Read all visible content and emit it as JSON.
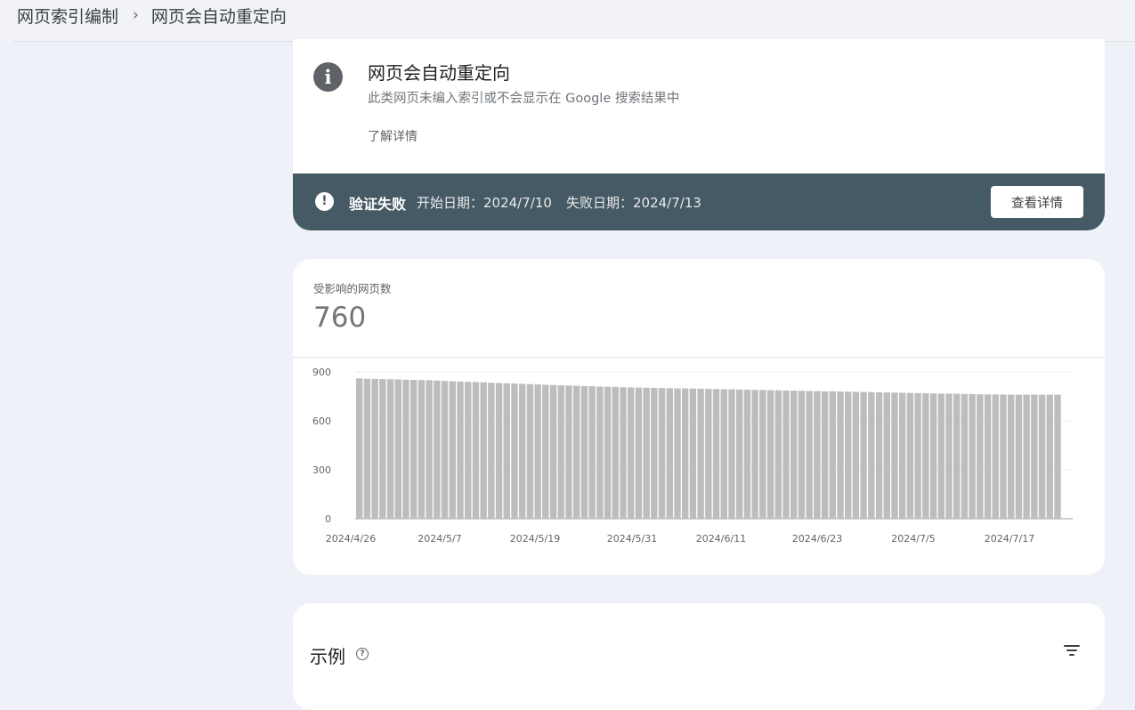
{
  "breadcrumb": {
    "parent": "网页索引编制",
    "separator": "›",
    "current": "网页会自动重定向"
  },
  "issue": {
    "icon": "info-icon",
    "icon_glyph": "i",
    "title": "网页会自动重定向",
    "subtitle": "此类网页未编入索引或不会显示在 Google 搜索结果中",
    "learn_more": "了解详情"
  },
  "validation": {
    "icon": "alert-icon",
    "icon_glyph": "!",
    "status": "验证失败",
    "start": "开始日期：2024/7/10",
    "fail": "失败日期：2024/7/13",
    "button": "查看详情",
    "bar_color": "#455a64"
  },
  "metric": {
    "label": "受影响的网页数",
    "value": "760"
  },
  "chart_data": {
    "type": "bar",
    "title": "",
    "xlabel": "",
    "ylabel": "",
    "ylim": [
      0,
      900
    ],
    "yticks": [
      0,
      300,
      600,
      900
    ],
    "xtick_labels": [
      "2024/4/26",
      "2024/5/7",
      "2024/5/19",
      "2024/5/31",
      "2024/6/11",
      "2024/6/23",
      "2024/7/5",
      "2024/7/17"
    ],
    "grid": true,
    "bar_color": "#bdbdbd",
    "x_start": "2024/4/26",
    "x_end": "2024/7/25",
    "values": [
      860,
      858,
      857,
      856,
      855,
      854,
      852,
      851,
      850,
      849,
      847,
      845,
      843,
      841,
      839,
      838,
      836,
      834,
      832,
      830,
      829,
      827,
      825,
      823,
      821,
      820,
      818,
      817,
      815,
      813,
      812,
      810,
      809,
      808,
      806,
      805,
      804,
      803,
      802,
      801,
      800,
      799,
      799,
      798,
      797,
      796,
      795,
      794,
      793,
      792,
      791,
      790,
      789,
      788,
      787,
      786,
      785,
      784,
      783,
      782,
      781,
      781,
      780,
      779,
      778,
      777,
      776,
      775,
      774,
      773,
      772,
      771,
      770,
      769,
      768,
      767,
      767,
      766,
      765,
      764,
      763,
      762,
      762,
      761,
      761,
      760,
      760,
      760,
      760,
      760,
      760
    ]
  },
  "examples": {
    "title": "示例",
    "help_icon": "help-icon",
    "help_glyph": "?",
    "filter_icon": "filter-icon"
  }
}
